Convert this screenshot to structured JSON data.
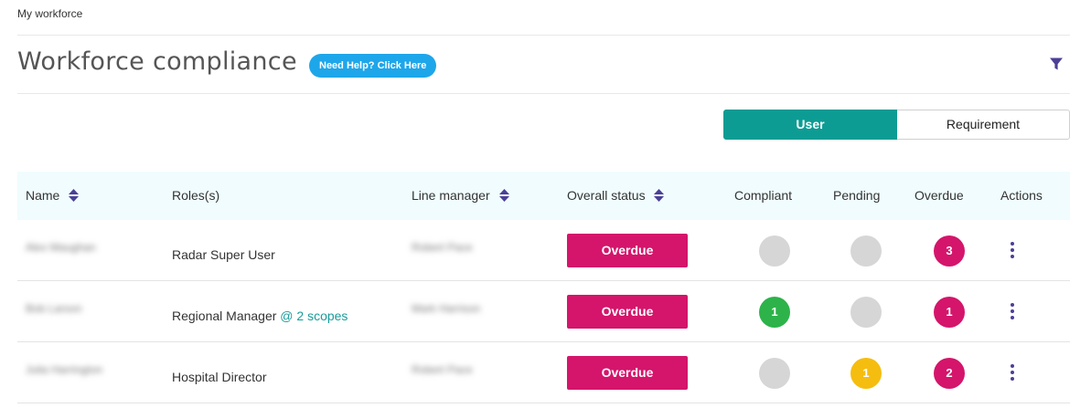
{
  "breadcrumb": "My workforce",
  "page_title": "Workforce compliance",
  "help_button": "Need Help? Click Here",
  "view_toggle": {
    "user": "User",
    "requirement": "Requirement",
    "selected": "User"
  },
  "table": {
    "headers": {
      "name": "Name",
      "roles": "Roles(s)",
      "line_manager": "Line manager",
      "overall_status": "Overall status",
      "compliant": "Compliant",
      "pending": "Pending",
      "overdue": "Overdue",
      "actions": "Actions"
    },
    "rows": [
      {
        "name": "Alex Maughan",
        "role": "Radar Super User",
        "role_scope": "",
        "line_manager": "Robert Pace",
        "status": "Overdue",
        "compliant": "",
        "pending": "",
        "overdue": "3"
      },
      {
        "name": "Bob Larson",
        "role": "Regional Manager ",
        "role_scope": "@ 2 scopes",
        "line_manager": "Mark Harrison",
        "status": "Overdue",
        "compliant": "1",
        "pending": "",
        "overdue": "1"
      },
      {
        "name": "Julia Harrington",
        "role": "Hospital Director",
        "role_scope": "",
        "line_manager": "Robert Pace",
        "status": "Overdue",
        "compliant": "",
        "pending": "1",
        "overdue": "2"
      }
    ]
  },
  "colors": {
    "accent_teal": "#0d9c94",
    "status_overdue": "#d4156b",
    "circle_empty": "#d6d6d6",
    "circle_compliant": "#2db34a",
    "circle_pending": "#f5bd0f",
    "circle_overdue": "#d4156b",
    "help_blue": "#1ea6ea",
    "icon_purple": "#4b3f96"
  }
}
